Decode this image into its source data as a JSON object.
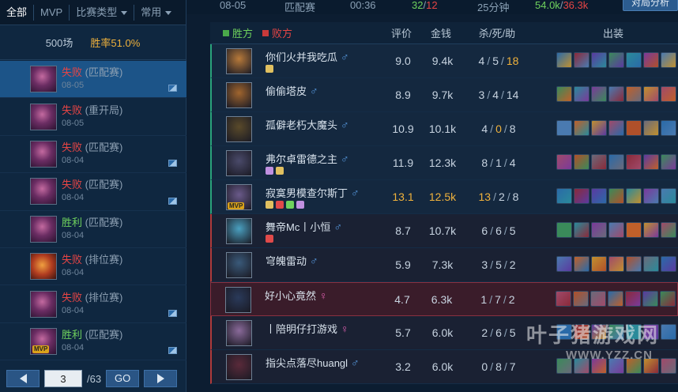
{
  "left": {
    "tabs": [
      {
        "label": "全部"
      },
      {
        "label": "MVP"
      },
      {
        "label": "比赛类型"
      },
      {
        "label": "常用"
      }
    ],
    "summary": {
      "games": "500场",
      "winrate": "胜率51.0%"
    },
    "matches": [
      {
        "result": "失败",
        "type": "(匹配赛)",
        "date": "08-05",
        "status": "lose"
      },
      {
        "result": "失败",
        "type": "(重开局)",
        "date": "08-05",
        "status": "lose"
      },
      {
        "result": "失败",
        "type": "(匹配赛)",
        "date": "08-04",
        "status": "lose"
      },
      {
        "result": "失败",
        "type": "(匹配赛)",
        "date": "08-04",
        "status": "lose"
      },
      {
        "result": "胜利",
        "type": "(匹配赛)",
        "date": "08-04",
        "status": "win"
      },
      {
        "result": "失败",
        "type": "(排位赛)",
        "date": "08-04",
        "status": "lose"
      },
      {
        "result": "失败",
        "type": "(排位赛)",
        "date": "08-04",
        "status": "lose"
      },
      {
        "result": "胜利",
        "type": "(匹配赛)",
        "date": "08-04",
        "status": "win",
        "mvp": "MVP"
      }
    ],
    "pager": {
      "current": "3",
      "total": "/63",
      "go": "GO"
    }
  },
  "top": {
    "date": "08-05",
    "mode": "匹配赛",
    "time": "00:36",
    "kills_a": "32",
    "kills_sep": "/",
    "kills_b": "12",
    "duration": "25分钟",
    "gold_a": "54.0k",
    "gold_sep": "/",
    "gold_b": "36.3k",
    "analysis": "对局分析"
  },
  "header": {
    "win_side": "胜方",
    "lose_side": "败方",
    "rating": "评价",
    "gold": "金钱",
    "kda": "杀/死/助",
    "items": "出装"
  },
  "players": [
    {
      "name": "你们火并我吃瓜",
      "gender": "♂",
      "rating": "9.0",
      "gold": "9.4k",
      "k": "4",
      "d": "5",
      "a": "18",
      "a_hl": true,
      "team": "a"
    },
    {
      "name": "偷偷塔皮",
      "gender": "♂",
      "rating": "8.9",
      "gold": "9.7k",
      "k": "3",
      "d": "4",
      "a": "14",
      "team": "a"
    },
    {
      "name": "孤僻老朽大魔头",
      "gender": "♂",
      "rating": "10.9",
      "gold": "10.1k",
      "k": "4",
      "d": "0",
      "a": "8",
      "d_hl": true,
      "team": "a"
    },
    {
      "name": "弗尔卓雷德之主",
      "gender": "♂",
      "rating": "11.9",
      "gold": "12.3k",
      "k": "8",
      "d": "1",
      "a": "4",
      "team": "a"
    },
    {
      "name": "寂寞男模查尔斯丁",
      "gender": "♂",
      "rating": "13.1",
      "gold": "12.5k",
      "k": "13",
      "d": "2",
      "a": "8",
      "rating_hl": true,
      "gold_hl": true,
      "k_hl": true,
      "team": "a",
      "mvp": "MVP"
    },
    {
      "name": "舞帝Mc丨小恒",
      "gender": "♂",
      "rating": "8.7",
      "gold": "10.7k",
      "k": "6",
      "d": "6",
      "a": "5",
      "team": "b"
    },
    {
      "name": "穹魄雷动",
      "gender": "♂",
      "rating": "5.9",
      "gold": "7.3k",
      "k": "3",
      "d": "5",
      "a": "2",
      "team": "b"
    },
    {
      "name": "好小心竟然",
      "gender": "♀",
      "rating": "4.7",
      "gold": "6.3k",
      "k": "1",
      "d": "7",
      "a": "2",
      "team": "b",
      "me": true
    },
    {
      "name": "丨陪明仔打游戏",
      "gender": "♀",
      "rating": "5.7",
      "gold": "6.0k",
      "k": "2",
      "d": "6",
      "a": "5",
      "team": "b"
    },
    {
      "name": "指尖点落尽huangl",
      "gender": "♂",
      "rating": "3.2",
      "gold": "6.0k",
      "k": "0",
      "d": "8",
      "a": "7",
      "team": "b"
    }
  ],
  "watermark": {
    "line1": "叶子猪游戏网",
    "line2": "WWW.YZZ.CN"
  },
  "colors": {
    "win": "#6fd25d",
    "lose": "#e64545",
    "highlight": "#f0b23c",
    "accent": "#1c5488"
  }
}
